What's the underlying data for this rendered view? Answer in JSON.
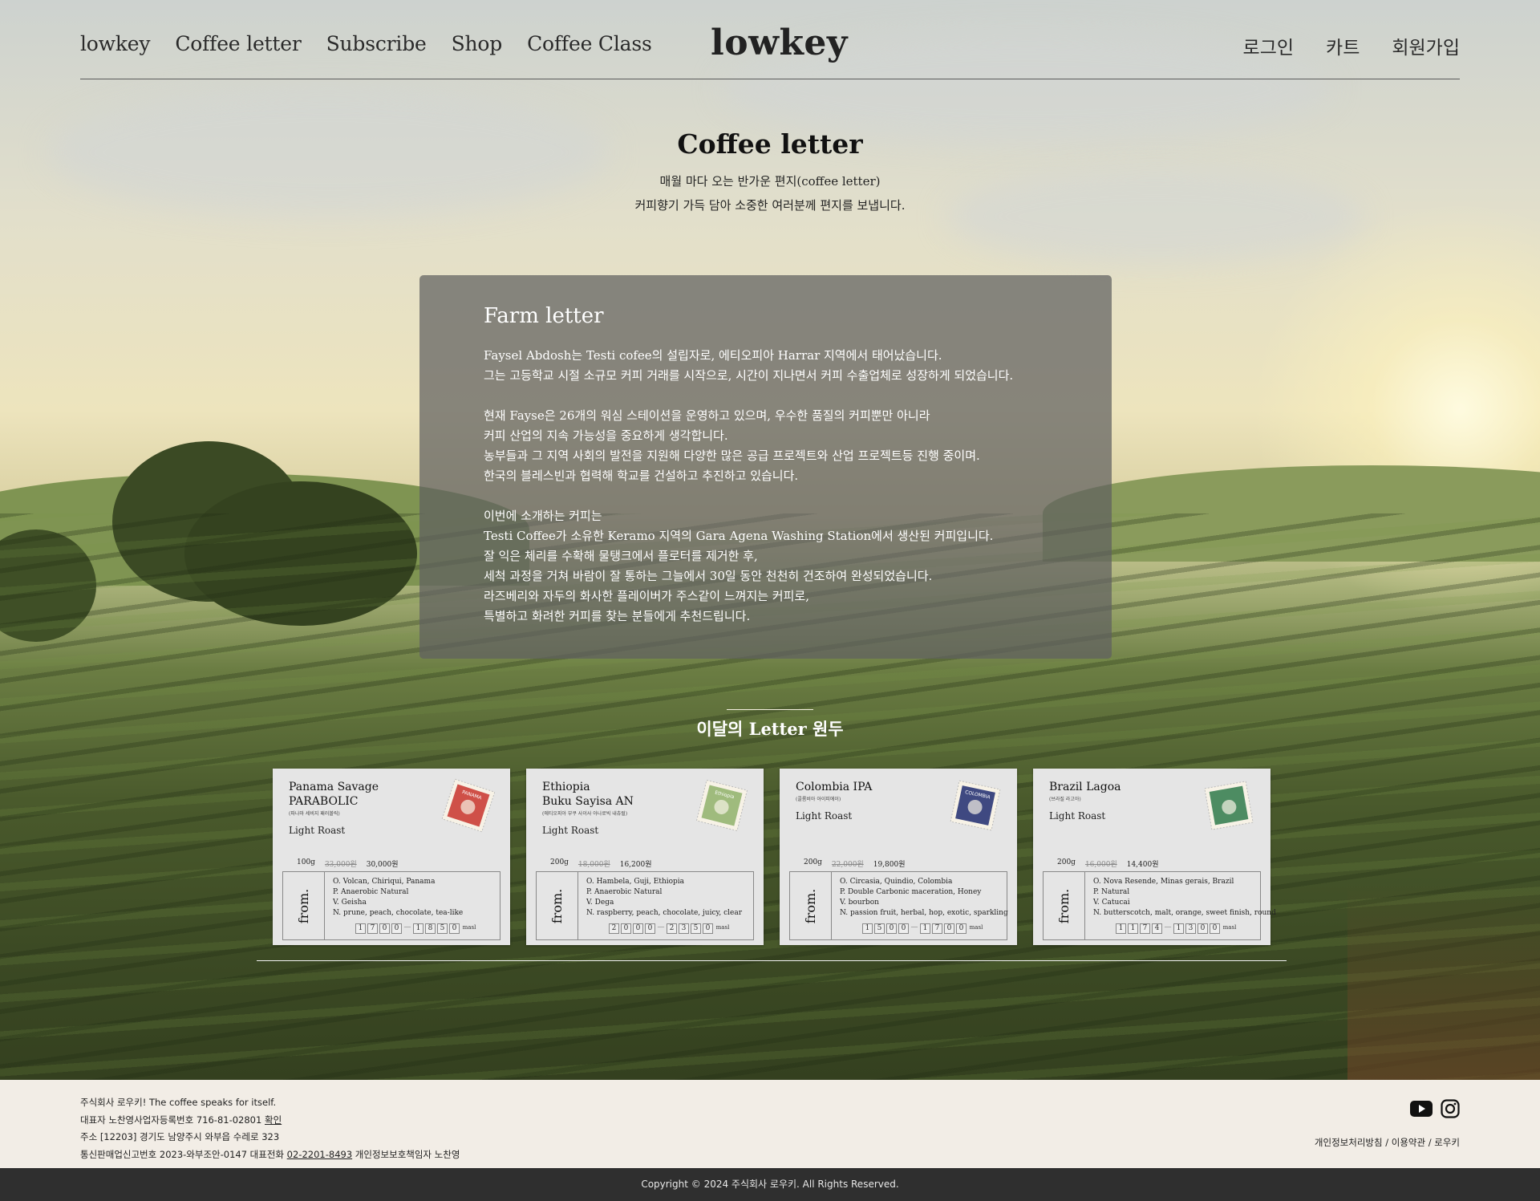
{
  "header": {
    "nav_left": [
      "lowkey",
      "Coffee letter",
      "Subscribe",
      "Shop",
      "Coffee Class"
    ],
    "logo": "lowkey",
    "nav_right": [
      "로그인",
      "카트",
      "회원가입"
    ]
  },
  "intro": {
    "title": "Coffee letter",
    "line1": "매월 마다 오는 반가운 편지(coffee letter)",
    "line2": "커피향기  가득 담아 소중한 여러분께 편지를 보냅니다."
  },
  "letter": {
    "title": "Farm letter",
    "p1": [
      "Faysel Abdosh는 Testi cofee의 설립자로, 에티오피아 Harrar 지역에서 태어났습니다.",
      "그는  고등학교 시절 소규모 커피 거래를 시작으로, 시간이 지나면서 커피 수출업체로 성장하게  되었습니다."
    ],
    "p2": [
      "현재 Fayse은 26개의 워심 스테이션을 운영하고 있으며, 우수한 품질의 커피뿐만 아니라",
      "커피 산업의 지속  가능성을 중요하게 생각합니다.",
      "농부들과 그 지역 사회의 발전을 지원해 다양한 많은  공급 프로젝트와  산업 프로젝트등 진행 중이며.",
      "한국의 블레스빈과 협력해 학교를 건설하고 추진하고 있습니다."
    ],
    "p3": [
      "이번에 소개하는 커피는",
      "Testi Coffee가 소유한 Keramo 지역의 Gara Agena Washing Station에서 생산된 커피입니다.",
      "잘 익은 체리를 수확해 물탱크에서 플로터를 제거한 후,",
      "세척  과정을 거쳐 바람이 잘 통하는 그늘에서 30일 동안 천천히 건조하여 완성되었습니다.",
      "라즈베리와 자두의 화사한 플레이버가 주스같이 느껴지는 커피로,",
      "특별하고 화려한 커피를 찾는 분들에게 추천드립니다."
    ]
  },
  "month": {
    "title": "이달의 Letter 원두",
    "cards": [
      {
        "name": "Panama Savage",
        "name2": "PARABOLIC",
        "sub": "(파나마 세비지 패러볼릭)",
        "roast": "Light Roast",
        "weight": "100g",
        "old_price": "33,000원",
        "price": "30,000원",
        "specs": [
          "O. Volcan, Chiriqui, Panama",
          "P. Anaerobic Natural",
          "V. Geisha",
          "N. prune, peach, chocolate, tea-like"
        ],
        "alt_a": [
          "1",
          "7",
          "0",
          "0"
        ],
        "alt_b": [
          "1",
          "8",
          "5",
          "0"
        ],
        "masl": "masl",
        "stamp_text": "PANAMA",
        "stamp_color": "#c8342c"
      },
      {
        "name": "Ethiopia",
        "name2": "Buku Sayisa AN",
        "sub": "(에티오피아 부쿠 사이사 아나로빅 내츄럴)",
        "roast": "Light Roast",
        "weight": "200g",
        "old_price": "18,000원",
        "price": "16,200원",
        "specs": [
          "O. Hambela, Guji, Ethiopia",
          "P. Anaerobic Natural",
          "V. Dega",
          "N. raspberry, peach, chocolate, juicy, clear"
        ],
        "alt_a": [
          "2",
          "0",
          "0",
          "0"
        ],
        "alt_b": [
          "2",
          "3",
          "5",
          "0"
        ],
        "masl": "masl",
        "stamp_text": "Ethiopia",
        "stamp_color": "#8fb26a"
      },
      {
        "name": "Colombia IPA",
        "name2": "",
        "sub": "(콜롬비아 아이피에이)",
        "roast": "Light Roast",
        "weight": "200g",
        "old_price": "22,000원",
        "price": "19,800원",
        "specs": [
          "O. Circasia, Quindio, Colombia",
          "P. Double Carbonic maceration, Honey",
          "V. bourbon",
          "N. passion fruit, herbal, hop, exotic, sparkling"
        ],
        "alt_a": [
          "1",
          "5",
          "0",
          "0"
        ],
        "alt_b": [
          "1",
          "7",
          "0",
          "0"
        ],
        "masl": "masl",
        "stamp_text": "COLOMBIA",
        "stamp_color": "#1e2b6e"
      },
      {
        "name": "Brazil Lagoa",
        "name2": "",
        "sub": "(브라질 라고아)",
        "roast": "Light Roast",
        "weight": "200g",
        "old_price": "16,000원",
        "price": "14,400원",
        "specs": [
          "O. Nova Resende, Minas gerais, Brazil",
          "P. Natural",
          "V. Catucai",
          "N. butterscotch, malt, orange, sweet finish, round"
        ],
        "alt_a": [
          "1",
          "1",
          "7",
          "4"
        ],
        "alt_b": [
          "1",
          "3",
          "0",
          "0"
        ],
        "masl": "masl",
        "stamp_text": "",
        "stamp_color": "#2f7a4a"
      }
    ]
  },
  "footer": {
    "line1": "주식회사 로우키! The coffee speaks for itself.",
    "line2_a": "대표자 노찬영사업자등록번호 716-81-02801 ",
    "line2_b": "확인",
    "line3": "주소 [12203] 경기도 남양주시 와부읍 수레로 323",
    "line4_a": "통신판매업신고번호 2023-와부조안-0147  대표전화 ",
    "line4_b": "02-2201-8493",
    "line4_c": "  개인정보보호책임자 노찬영",
    "links": "개인정보처리방침 / 이용약관 / 로우키",
    "copyright": "Copyright © 2024 주식회사 로우키. All Rights Reserved."
  }
}
